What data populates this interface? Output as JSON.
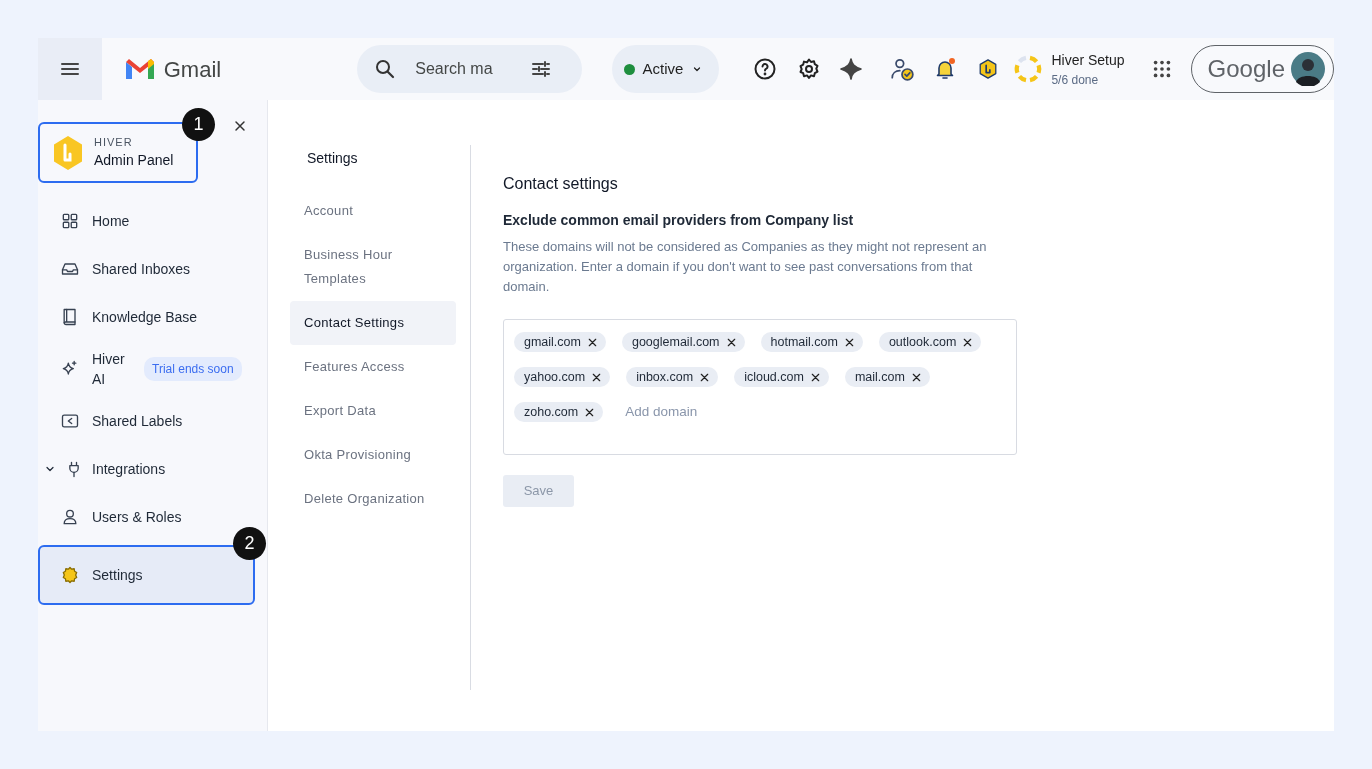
{
  "header": {
    "app_name": "Gmail",
    "search": {
      "placeholder": "Search ma"
    },
    "status": {
      "label": "Active",
      "color": "#1e8e3e"
    },
    "notifications": {
      "unread": true
    },
    "setup": {
      "title": "Hiver Setup",
      "progress": "5/6 done",
      "level": 0.83
    },
    "account_label": "Google"
  },
  "sidebar": {
    "brand": {
      "label": "HIVER",
      "title": "Admin Panel",
      "callout": "1"
    },
    "items": [
      {
        "label": "Home",
        "selected": false
      },
      {
        "label": "Shared Inboxes",
        "selected": false
      },
      {
        "label": "Knowledge Base",
        "selected": false
      },
      {
        "label": "Hiver AI",
        "selected": false,
        "badge": "Trial ends soon"
      },
      {
        "label": "Shared Labels",
        "selected": false
      },
      {
        "label": "Integrations",
        "selected": false,
        "expandable": true
      },
      {
        "label": "Users & Roles",
        "selected": false
      },
      {
        "label": "Settings",
        "selected": true,
        "callout": "2"
      }
    ]
  },
  "settings_nav": {
    "title": "Settings",
    "items": [
      {
        "label": "Account",
        "selected": false
      },
      {
        "label": "Business Hour Templates",
        "selected": false
      },
      {
        "label": "Contact Settings",
        "selected": true
      },
      {
        "label": "Features Access",
        "selected": false
      },
      {
        "label": "Export Data",
        "selected": false
      },
      {
        "label": "Okta Provisioning",
        "selected": false
      },
      {
        "label": "Delete Organization",
        "selected": false
      }
    ]
  },
  "content": {
    "title": "Contact settings",
    "subtitle": "Exclude common email providers from Company list",
    "description": "These domains will not be considered as Companies as they might not represent an organization. Enter a domain if you don't want to see past conversations from that domain.",
    "domains": [
      "gmail.com",
      "googlemail.com",
      "hotmail.com",
      "outlook.com",
      "yahoo.com",
      "inbox.com",
      "icloud.com",
      "mail.com",
      "zoho.com"
    ],
    "add_placeholder": "Add domain",
    "save": {
      "label": "Save",
      "disabled": true
    }
  }
}
